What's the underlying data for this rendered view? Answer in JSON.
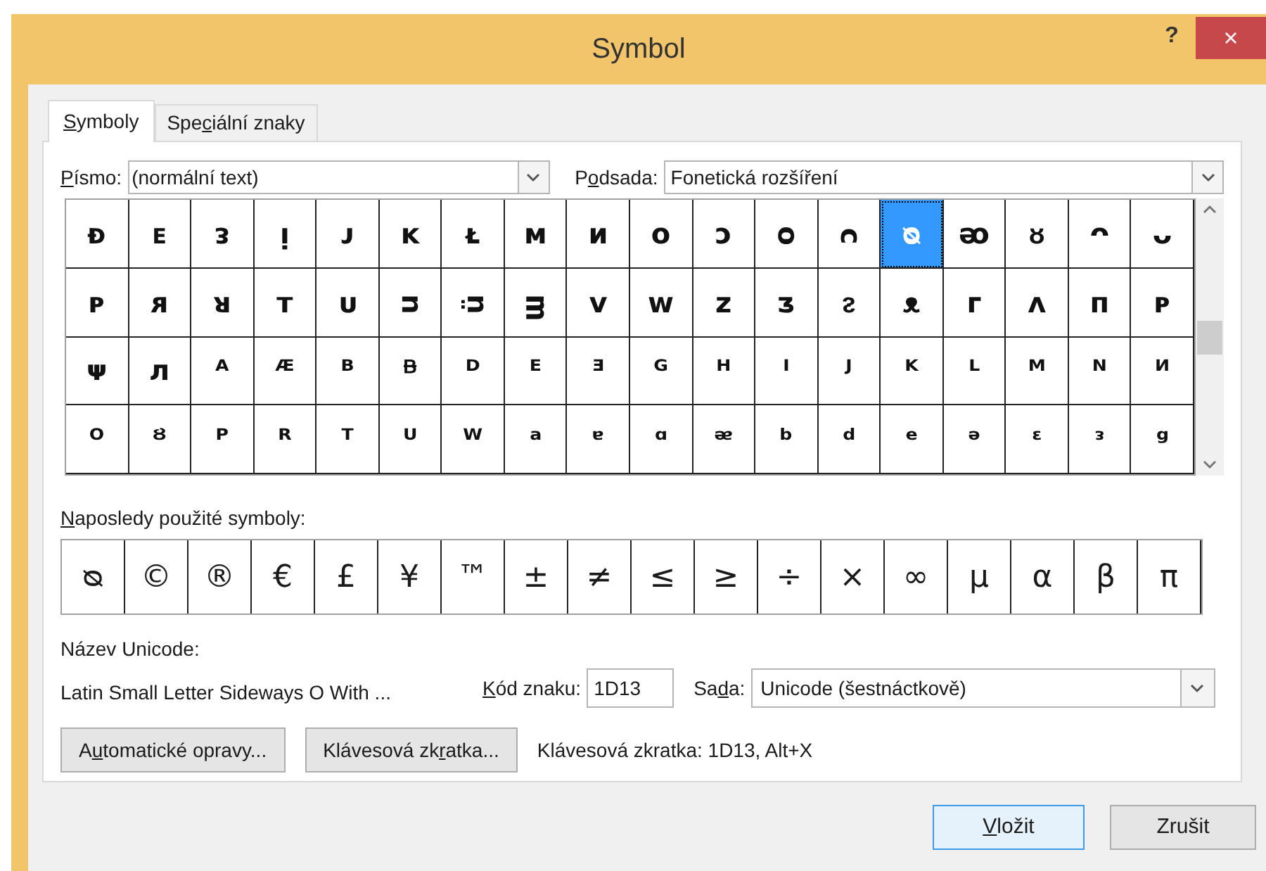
{
  "window": {
    "title": "Symbol",
    "help": "?",
    "close": "×"
  },
  "tabs": [
    {
      "key": "S",
      "post": "ymboly",
      "selected": true
    },
    {
      "pre": "Spe",
      "key": "c",
      "post": "iální znaky",
      "selected": false
    }
  ],
  "font": {
    "label": {
      "key": "P",
      "post": "ísmo:"
    },
    "value": "(normální text)"
  },
  "subset": {
    "label": {
      "pre": "P",
      "key": "o",
      "post": "dsada:"
    },
    "value": "Fonetická rozšíření"
  },
  "grid": [
    [
      {
        "char": "ᴆ",
        "selected": false
      },
      {
        "char": "ᴇ",
        "selected": false
      },
      {
        "char": "ᴈ",
        "selected": false
      },
      {
        "char": "ᴉ",
        "selected": false
      },
      {
        "char": "ᴊ",
        "selected": false
      },
      {
        "char": "ᴋ",
        "selected": false
      },
      {
        "char": "ᴌ",
        "selected": false
      },
      {
        "char": "ᴍ",
        "selected": false
      },
      {
        "char": "ᴎ",
        "selected": false
      },
      {
        "char": "ᴏ",
        "selected": false
      },
      {
        "char": "ᴐ",
        "selected": false
      },
      {
        "char": "ᴑ",
        "selected": false
      },
      {
        "char": "ᴒ",
        "selected": false
      },
      {
        "char": "ᴓ",
        "selected": true
      },
      {
        "char": "ᴔ",
        "selected": false
      },
      {
        "char": "ᴕ",
        "selected": false
      },
      {
        "char": "ᴖ",
        "selected": false
      },
      {
        "char": "ᴗ",
        "selected": false
      }
    ],
    [
      {
        "char": "ᴘ",
        "selected": false
      },
      {
        "char": "ᴙ",
        "selected": false
      },
      {
        "char": "ᴚ",
        "selected": false
      },
      {
        "char": "ᴛ",
        "selected": false
      },
      {
        "char": "ᴜ",
        "selected": false
      },
      {
        "char": "ᴝ",
        "selected": false
      },
      {
        "char": "ᴞ",
        "selected": false
      },
      {
        "char": "ᴟ",
        "selected": false
      },
      {
        "char": "ᴠ",
        "selected": false
      },
      {
        "char": "ᴡ",
        "selected": false
      },
      {
        "char": "ᴢ",
        "selected": false
      },
      {
        "char": "ᴣ",
        "selected": false
      },
      {
        "char": "ᴤ",
        "selected": false
      },
      {
        "char": "ᴥ",
        "selected": false
      },
      {
        "char": "ᴦ",
        "selected": false
      },
      {
        "char": "ᴧ",
        "selected": false
      },
      {
        "char": "ᴨ",
        "selected": false
      },
      {
        "char": "ᴩ",
        "selected": false
      }
    ],
    [
      {
        "char": "ᴪ",
        "selected": false
      },
      {
        "char": "ᴫ",
        "selected": false
      },
      {
        "char": "ᴬ",
        "selected": false
      },
      {
        "char": "ᴭ",
        "selected": false
      },
      {
        "char": "ᴮ",
        "selected": false
      },
      {
        "char": "ᴯ",
        "selected": false
      },
      {
        "char": "ᴰ",
        "selected": false
      },
      {
        "char": "ᴱ",
        "selected": false
      },
      {
        "char": "ᴲ",
        "selected": false
      },
      {
        "char": "ᴳ",
        "selected": false
      },
      {
        "char": "ᴴ",
        "selected": false
      },
      {
        "char": "ᴵ",
        "selected": false
      },
      {
        "char": "ᴶ",
        "selected": false
      },
      {
        "char": "ᴷ",
        "selected": false
      },
      {
        "char": "ᴸ",
        "selected": false
      },
      {
        "char": "ᴹ",
        "selected": false
      },
      {
        "char": "ᴺ",
        "selected": false
      },
      {
        "char": "ᴻ",
        "selected": false
      }
    ],
    [
      {
        "char": "ᴼ",
        "selected": false
      },
      {
        "char": "ᴽ",
        "selected": false
      },
      {
        "char": "ᴾ",
        "selected": false
      },
      {
        "char": "ᴿ",
        "selected": false
      },
      {
        "char": "ᵀ",
        "selected": false
      },
      {
        "char": "ᵁ",
        "selected": false
      },
      {
        "char": "ᵂ",
        "selected": false
      },
      {
        "char": "ᵃ",
        "selected": false
      },
      {
        "char": "ᵄ",
        "selected": false
      },
      {
        "char": "ᵅ",
        "selected": false
      },
      {
        "char": "ᵆ",
        "selected": false
      },
      {
        "char": "ᵇ",
        "selected": false
      },
      {
        "char": "ᵈ",
        "selected": false
      },
      {
        "char": "ᵉ",
        "selected": false
      },
      {
        "char": "ᵊ",
        "selected": false
      },
      {
        "char": "ᵋ",
        "selected": false
      },
      {
        "char": "ᵌ",
        "selected": false
      },
      {
        "char": "ᵍ",
        "selected": false
      }
    ]
  ],
  "recent": {
    "label": {
      "key": "N",
      "post": "aposledy použité symboly:"
    },
    "symbols": [
      "ᴓ",
      "©",
      "®",
      "€",
      "£",
      "¥",
      "™",
      "±",
      "≠",
      "≤",
      "≥",
      "÷",
      "×",
      "∞",
      "µ",
      "α",
      "β",
      "π"
    ]
  },
  "unicode_name": {
    "label": "Název Unicode:",
    "value": "Latin Small Letter Sideways O With ..."
  },
  "char_code": {
    "label": {
      "key": "K",
      "post": "ód znaku:"
    },
    "value": "1D13"
  },
  "set": {
    "label": {
      "pre": "Sa",
      "key": "d",
      "post": "a:"
    },
    "value": "Unicode (šestnáctkově)"
  },
  "autocorrect_button": {
    "pre": "A",
    "key": "u",
    "post": "tomatické opravy..."
  },
  "shortcut_button": {
    "pre": "Klávesová zk",
    "key": "r",
    "post": "atka..."
  },
  "shortcut_text": "Klávesová zkratka: 1D13, Alt+X",
  "insert_button": {
    "key": "V",
    "post": "ložit"
  },
  "cancel_button": "Zrušit"
}
